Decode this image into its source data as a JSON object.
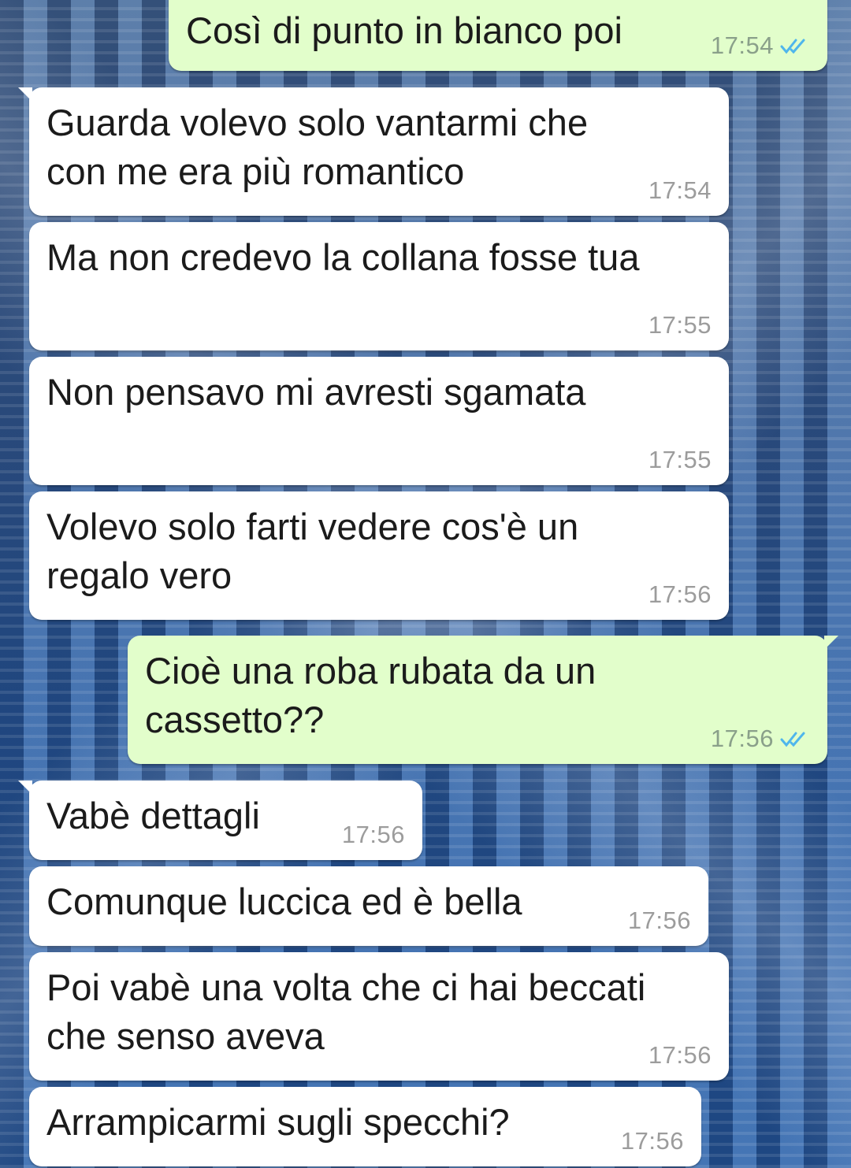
{
  "colors": {
    "incoming_bubble": "#ffffff",
    "outgoing_bubble": "#e2fecb",
    "read_ticks": "#4fb6ec",
    "time_text": "#9c9c9c"
  },
  "messages": [
    {
      "dir": "out",
      "text": "Così di punto in bianco poi",
      "time": "17:54",
      "status": "read",
      "status_icon": "double-check-icon"
    },
    {
      "dir": "in",
      "text": "Guarda volevo solo vantarmi che\ncon me era più romantico",
      "time": "17:54"
    },
    {
      "dir": "in",
      "text": "Ma non credevo la collana fosse tua",
      "time": "17:55"
    },
    {
      "dir": "in",
      "text": "Non pensavo mi avresti sgamata",
      "time": "17:55"
    },
    {
      "dir": "in",
      "text": "Volevo solo farti vedere cos'è un\nregalo vero",
      "time": "17:56"
    },
    {
      "dir": "out",
      "text": "Cioè una roba rubata da un\ncassetto??",
      "time": "17:56",
      "status": "read",
      "status_icon": "double-check-icon"
    },
    {
      "dir": "in",
      "text": "Vabè dettagli",
      "time": "17:56"
    },
    {
      "dir": "in",
      "text": "Comunque luccica ed è bella",
      "time": "17:56"
    },
    {
      "dir": "in",
      "text": "Poi vabè una volta che ci hai beccati\nche senso aveva",
      "time": "17:56"
    },
    {
      "dir": "in",
      "text": "Arrampicarmi sugli specchi?",
      "time": "17:56"
    }
  ]
}
